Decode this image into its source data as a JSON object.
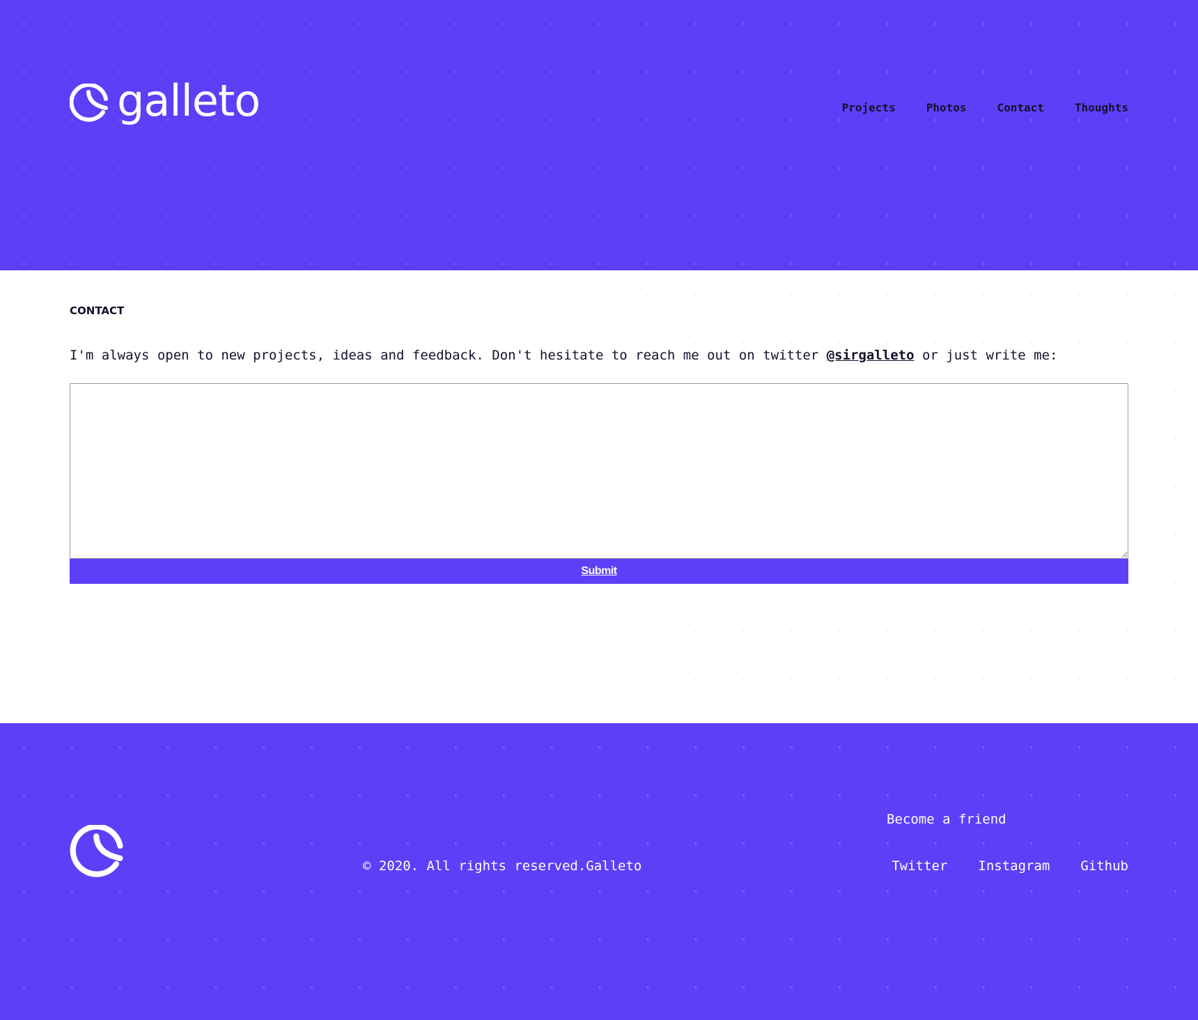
{
  "colors": {
    "brand": "#5b40f8",
    "text": "#14112b"
  },
  "header": {
    "logo_text": "galleto",
    "logo_icon": "galleto-cookie-icon",
    "nav": [
      {
        "label": "Projects"
      },
      {
        "label": "Photos"
      },
      {
        "label": "Contact"
      },
      {
        "label": "Thoughts"
      }
    ]
  },
  "main": {
    "section_label": "CONTACT",
    "intro_before": "I'm always open to new projects, ideas and feedback. Don't hesitate to reach me out on twitter ",
    "twitter_handle": "@sirgalleto",
    "intro_after": " or just write me:",
    "message_value": "",
    "submit_label": "Submit"
  },
  "footer": {
    "logo_icon": "galleto-cookie-icon",
    "copyright": "© 2020. All rights reserved.Galleto",
    "friend_label": "Become a friend",
    "social": [
      {
        "label": "Twitter"
      },
      {
        "label": "Instagram"
      },
      {
        "label": "Github"
      }
    ]
  }
}
